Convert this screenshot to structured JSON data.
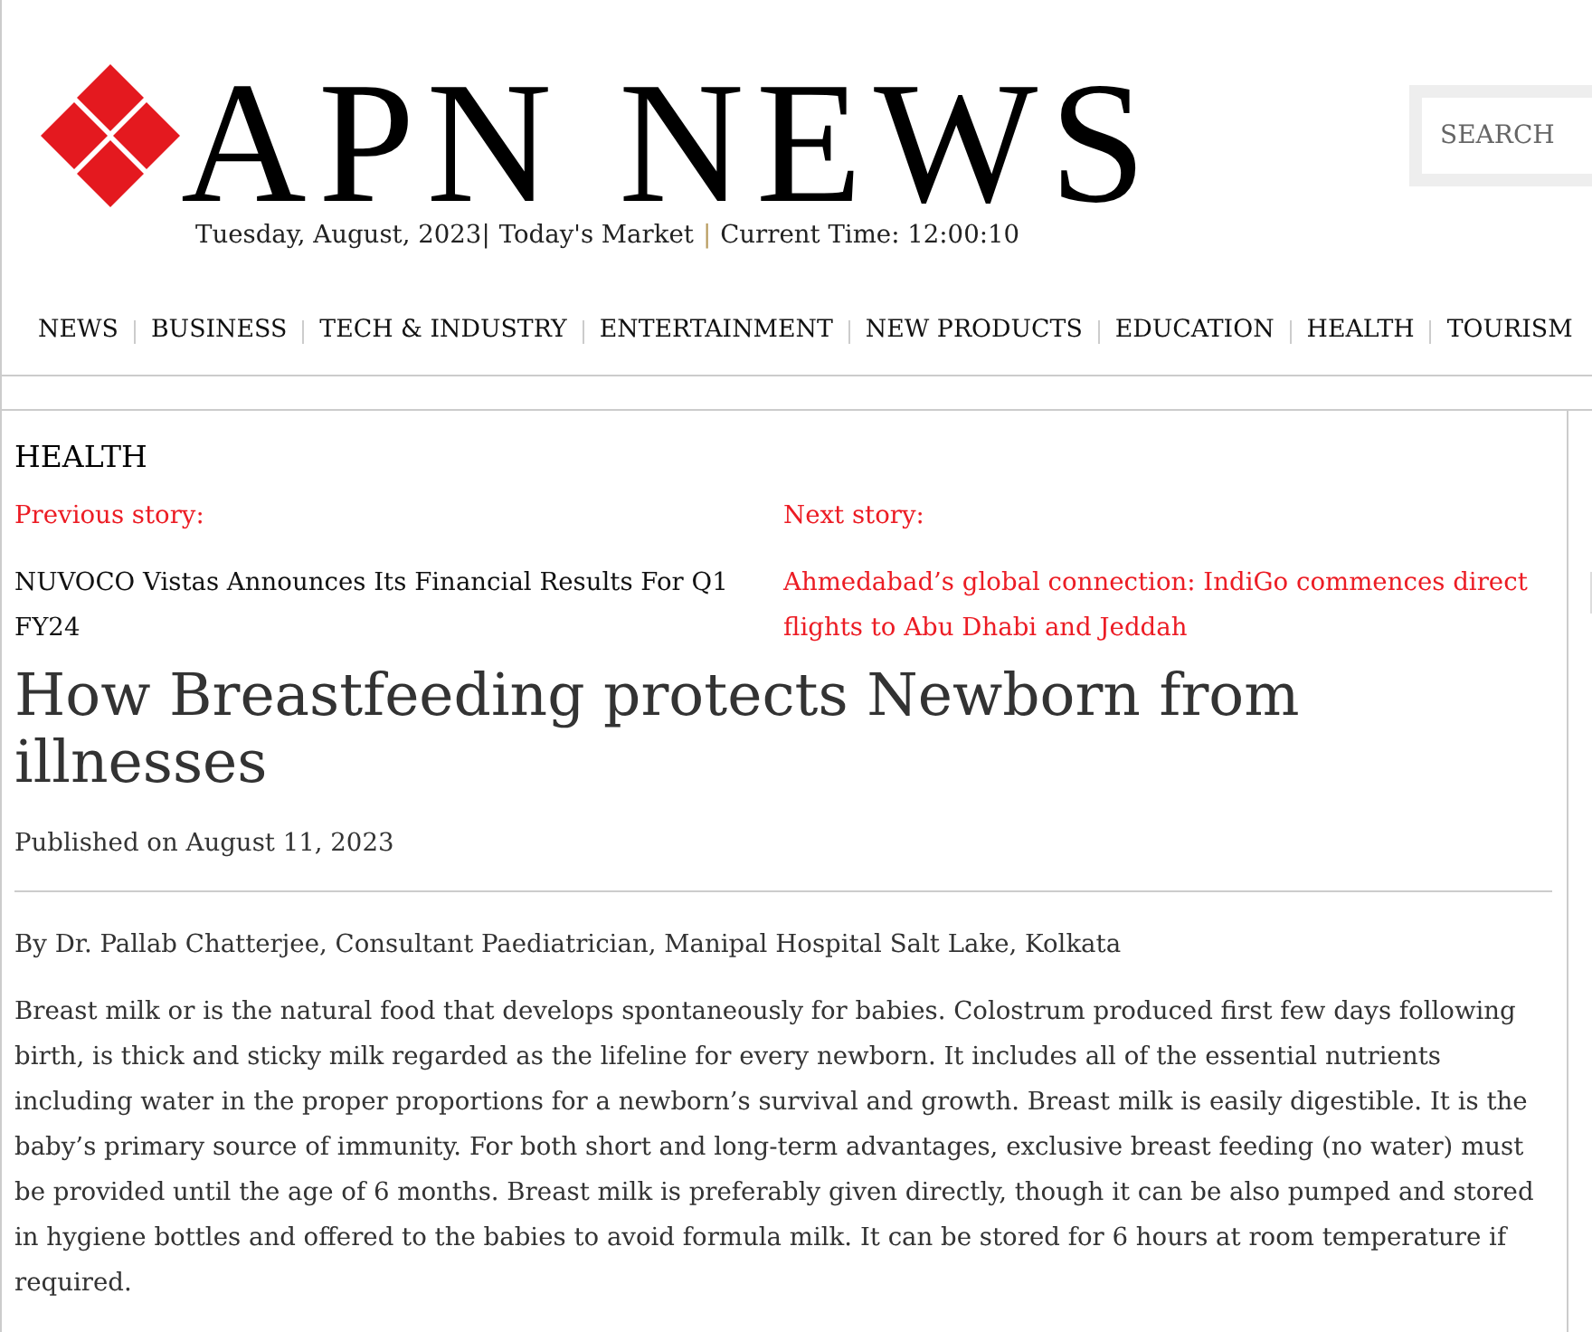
{
  "header": {
    "logo_text": "APN NEWS",
    "date_line": [
      {
        "kind": "text",
        "text": "Tuesday, August, 2023|"
      },
      {
        "kind": "link",
        "text": "Today's Market"
      },
      {
        "kind": "separator",
        "text": "|"
      },
      {
        "kind": "text",
        "text": "Current Time: 12:00:10"
      }
    ],
    "search": {
      "placeholder": "SEARCH"
    }
  },
  "nav": [
    "NEWS",
    "BUSINESS",
    "TECH & INDUSTRY",
    "ENTERTAINMENT",
    "NEW PRODUCTS",
    "EDUCATION",
    "HEALTH",
    "TOURISM"
  ],
  "article": {
    "category": "HEALTH",
    "previous": {
      "label": "Previous story:",
      "title": "NUVOCO Vistas Announces Its Financial Results For Q1 FY24"
    },
    "next": {
      "label": "Next story:",
      "title": "Ahmedabad’s global connection: IndiGo commences direct flights to Abu Dhabi and Jeddah"
    },
    "title": "How Breastfeeding protects Newborn from illnesses",
    "published": "Published on August 11, 2023",
    "byline": "By Dr. Pallab Chatterjee, Consultant Paediatrician, Manipal Hospital Salt Lake, Kolkata",
    "paragraphs": [
      "Breast milk or is the natural food that develops spontaneously for babies. Colostrum produced first few days following birth, is thick and sticky milk regarded as the lifeline for every newborn. It includes all of the essential nutrients including water in the proper proportions for a newborn’s survival and growth. Breast milk is easily digestible. It is the baby’s primary source of immunity. For both short and long-term advantages, exclusive breast feeding (no water) must be provided until the age of 6 months. Breast milk is preferably given directly, though it can be also pumped and stored in hygiene bottles and offered to the babies to avoid formula milk. It can be stored for 6 hours at room temperature if required."
    ]
  }
}
